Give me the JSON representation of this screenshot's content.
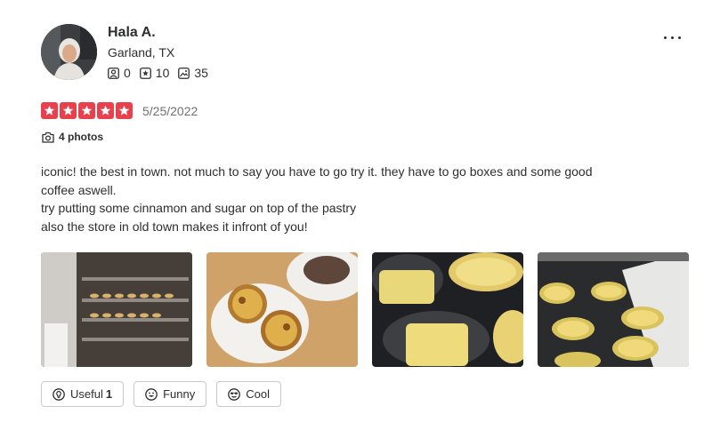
{
  "user": {
    "name": "Hala A.",
    "location": "Garland, TX",
    "friends_count": "0",
    "reviews_count": "10",
    "photos_count": "35"
  },
  "review": {
    "rating": 5,
    "date": "5/25/2022",
    "photos_label": "4 photos",
    "text_lines": [
      "iconic! the best in town. not much to say you have to go try it. they have to go boxes and some good",
      "coffee aswell.",
      "try putting some cinnamon and sugar on top of the pastry",
      "also the store in old town makes it infront of you!"
    ]
  },
  "reactions": {
    "useful_label": "Useful",
    "useful_count": "1",
    "funny_label": "Funny",
    "cool_label": "Cool"
  },
  "colors": {
    "star_red": "#e8414e",
    "text": "#2d2e2f",
    "muted": "#6e7072",
    "border": "#c8c9ca"
  },
  "icons": {
    "more": "more-options-icon",
    "friends": "friends-icon",
    "reviews": "review-star-icon",
    "photos": "photo-icon",
    "camera": "camera-icon",
    "useful": "lightbulb-icon",
    "funny": "smiley-icon",
    "cool": "sunglasses-icon"
  }
}
